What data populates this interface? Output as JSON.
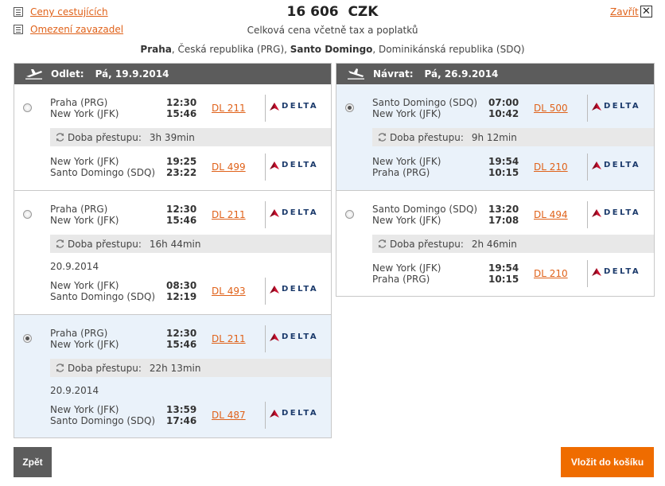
{
  "links": {
    "fares": "Ceny cestujících",
    "baggage": "Omezení zavazadel",
    "close": "Zavřít"
  },
  "price": {
    "amount": "16 606",
    "currency": "CZK",
    "note": "Celková cena včetně tax a poplatků"
  },
  "route": {
    "origin_city": "Praha",
    "origin_rest": ", Česká republika (PRG), ",
    "dest_city": "Santo Domingo",
    "dest_rest": ", Dominikánská republika (SDQ)"
  },
  "outbound": {
    "label": "Odlet:",
    "date": "Pá, 19.9.2014",
    "options": [
      {
        "selected": false,
        "seg1": {
          "from": "Praha (PRG)",
          "to": "New York (JFK)",
          "dep": "12:30",
          "arr": "15:46",
          "flight": "DL 211",
          "airline": "DELTA"
        },
        "transfer_label": "Doba přestupu:",
        "transfer_time": "3h 39min",
        "next_date": "",
        "seg2": {
          "from": "New York (JFK)",
          "to": "Santo Domingo (SDQ)",
          "dep": "19:25",
          "arr": "23:22",
          "flight": "DL 499",
          "airline": "DELTA"
        }
      },
      {
        "selected": false,
        "seg1": {
          "from": "Praha (PRG)",
          "to": "New York (JFK)",
          "dep": "12:30",
          "arr": "15:46",
          "flight": "DL 211",
          "airline": "DELTA"
        },
        "transfer_label": "Doba přestupu:",
        "transfer_time": "16h 44min",
        "next_date": "20.9.2014",
        "seg2": {
          "from": "New York (JFK)",
          "to": "Santo Domingo (SDQ)",
          "dep": "08:30",
          "arr": "12:19",
          "flight": "DL 493",
          "airline": "DELTA"
        }
      },
      {
        "selected": true,
        "seg1": {
          "from": "Praha (PRG)",
          "to": "New York (JFK)",
          "dep": "12:30",
          "arr": "15:46",
          "flight": "DL 211",
          "airline": "DELTA"
        },
        "transfer_label": "Doba přestupu:",
        "transfer_time": "22h 13min",
        "next_date": "20.9.2014",
        "seg2": {
          "from": "New York (JFK)",
          "to": "Santo Domingo (SDQ)",
          "dep": "13:59",
          "arr": "17:46",
          "flight": "DL 487",
          "airline": "DELTA"
        }
      }
    ]
  },
  "return": {
    "label": "Návrat:",
    "date": "Pá, 26.9.2014",
    "options": [
      {
        "selected": true,
        "seg1": {
          "from": "Santo Domingo (SDQ)",
          "to": "New York (JFK)",
          "dep": "07:00",
          "arr": "10:42",
          "flight": "DL 500",
          "airline": "DELTA"
        },
        "transfer_label": "Doba přestupu:",
        "transfer_time": "9h 12min",
        "next_date": "",
        "seg2": {
          "from": "New York (JFK)",
          "to": "Praha (PRG)",
          "dep": "19:54",
          "arr": "10:15",
          "flight": "DL 210",
          "airline": "DELTA"
        }
      },
      {
        "selected": false,
        "seg1": {
          "from": "Santo Domingo (SDQ)",
          "to": "New York (JFK)",
          "dep": "13:20",
          "arr": "17:08",
          "flight": "DL 494",
          "airline": "DELTA"
        },
        "transfer_label": "Doba přestupu:",
        "transfer_time": "2h 46min",
        "next_date": "",
        "seg2": {
          "from": "New York (JFK)",
          "to": "Praha (PRG)",
          "dep": "19:54",
          "arr": "10:15",
          "flight": "DL 210",
          "airline": "DELTA"
        }
      }
    ]
  },
  "buttons": {
    "back": "Zpět",
    "add_to_cart": "Vložit do košíku"
  },
  "colors": {
    "accent": "#ef6c00",
    "link": "#e0621a",
    "header": "#5c5c5c",
    "selected_bg": "#eaf2fa",
    "delta_red": "#c8102e",
    "delta_blue": "#1b3a6b"
  }
}
